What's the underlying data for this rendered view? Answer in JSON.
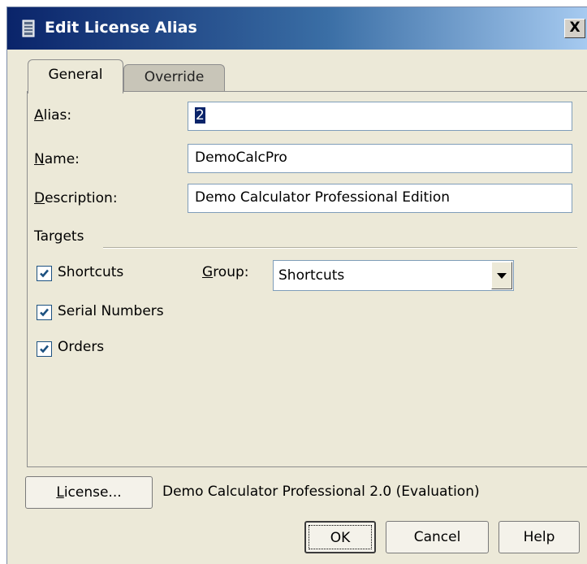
{
  "window": {
    "title": "Edit License Alias",
    "close_glyph": "X",
    "icon": "license-tower-icon"
  },
  "tabs": [
    {
      "label": "General",
      "active": true
    },
    {
      "label": "Override",
      "active": false
    }
  ],
  "fields": {
    "alias": {
      "label": "Alias:",
      "mnemonic": "A",
      "rest": "lias:",
      "value": "2"
    },
    "name": {
      "label": "Name:",
      "mnemonic": "N",
      "rest": "ame:",
      "value": "DemoCalcPro"
    },
    "description": {
      "label": "Description:",
      "mnemonic": "D",
      "rest": "escription:",
      "value": "Demo Calculator Professional Edition"
    }
  },
  "targets": {
    "section_label": "Targets",
    "items": [
      {
        "label": "Shortcuts",
        "checked": true
      },
      {
        "label": "Serial Numbers",
        "checked": true
      },
      {
        "label": "Orders",
        "checked": true
      }
    ],
    "group": {
      "label": "Group:",
      "mnemonic": "G",
      "rest": "roup:",
      "value": "Shortcuts"
    }
  },
  "license": {
    "button_label": "License...",
    "mnemonic": "L",
    "rest": "icense...",
    "product": "Demo Calculator Professional 2.0 (Evaluation)"
  },
  "buttons": {
    "ok": "OK",
    "cancel": "Cancel",
    "help": "Help"
  },
  "colors": {
    "title_start": "#0a246a",
    "title_end": "#a6caf0",
    "dialog_bg": "#ece9d8",
    "check": "#1c5180"
  }
}
